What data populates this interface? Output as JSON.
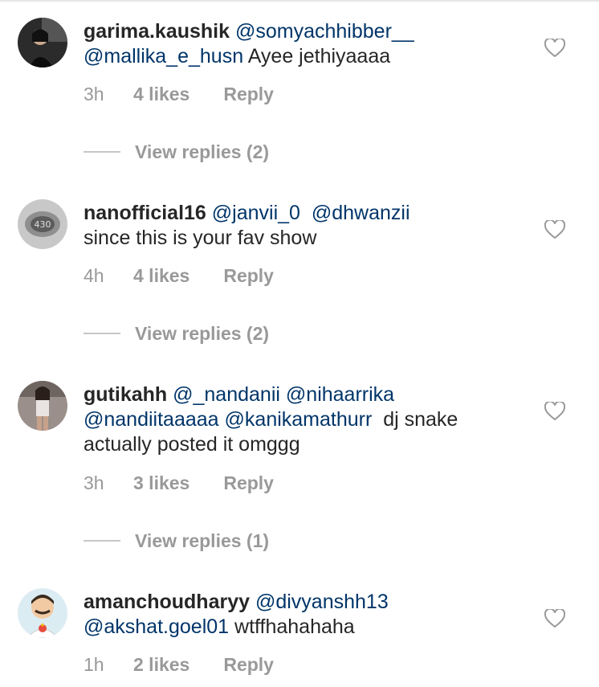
{
  "comments": [
    {
      "username": "garima.kaushik",
      "text": [
        "@somyachhibber__",
        "@mallika_e_husn",
        "Ayee jethiyaaaa"
      ],
      "time": "3h",
      "likes": "4 likes",
      "reply": "Reply",
      "view_replies": "View replies (2)",
      "avatar_icon": "person-avatar-dark"
    },
    {
      "username": "nanofficial16",
      "text": [
        "@janvii_0",
        "@dhwanzii",
        "since this is your fav show"
      ],
      "time": "4h",
      "likes": "4 likes",
      "reply": "Reply",
      "view_replies": "View replies (2)",
      "avatar_icon": "logo-avatar-grey"
    },
    {
      "username": "gutikahh",
      "text": [
        "@_nandanii",
        "@nihaarrika",
        "@nandiitaaaaa",
        "@kanikamathurr",
        "dj snake",
        "actually posted it omggg"
      ],
      "time": "3h",
      "likes": "3 likes",
      "reply": "Reply",
      "view_replies": "View replies (1)",
      "avatar_icon": "person-avatar-photo"
    },
    {
      "username": "amanchoudharyy",
      "text": [
        "@divyanshh13",
        "@akshat.goel01",
        "wtffhahahaha"
      ],
      "time": "1h",
      "likes": "2 likes",
      "reply": "Reply",
      "avatar_icon": "cartoon-avatar"
    }
  ],
  "icons": {
    "like": "heart-outline-icon"
  },
  "colors": {
    "mention": "#003569",
    "muted": "#999999",
    "text": "#262626"
  }
}
